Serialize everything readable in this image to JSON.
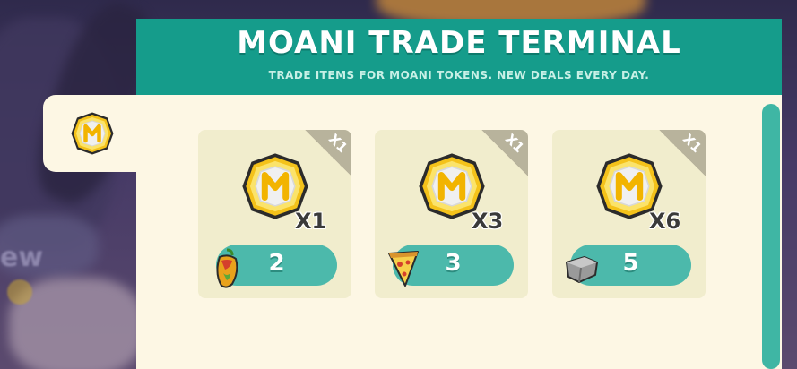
{
  "shop": {
    "title": "MOANI TRADE TERMINAL",
    "subtitle": "TRADE ITEMS FOR MOANI TOKENS. NEW DEALS EVERY DAY."
  },
  "background": {
    "partial_label": "ew"
  },
  "category_tab": {
    "icon": "moani-token-icon"
  },
  "offers": [
    {
      "corner_label": "X1",
      "reward_icon": "moani-token-icon",
      "reward_qty": "X1",
      "cost_icon": "pepper-icon",
      "price": "2"
    },
    {
      "corner_label": "X1",
      "reward_icon": "moani-token-icon",
      "reward_qty": "X3",
      "cost_icon": "pizza-slice-icon",
      "price": "3"
    },
    {
      "corner_label": "X1",
      "reward_icon": "moani-token-icon",
      "reward_qty": "X6",
      "cost_icon": "stone-brick-icon",
      "price": "5"
    }
  ],
  "colors": {
    "header": "#159c8b",
    "panel": "#fdf7e4",
    "card": "#f1edcd",
    "price_button": "#4cb9ab",
    "token_gold": "#f4c21a"
  }
}
